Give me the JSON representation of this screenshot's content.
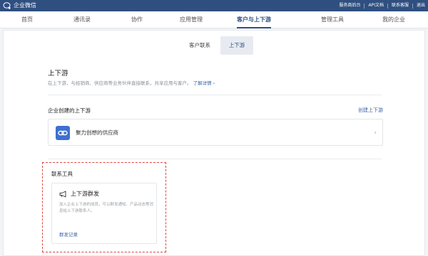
{
  "topbar": {
    "brand": "企业微信",
    "links": [
      "服务商后台",
      "API文档",
      "联系客服",
      "退出"
    ]
  },
  "nav": {
    "items": [
      "首页",
      "通讯录",
      "协作",
      "应用管理",
      "客户与上下游",
      "管理工具",
      "我的企业"
    ],
    "active": "客户与上下游"
  },
  "subtabs": {
    "items": [
      "客户联系",
      "上下游"
    ],
    "active": "上下游"
  },
  "section": {
    "title": "上下游",
    "description": "在上下游，与经销商、供应商等业务伙伴直接联系，共享应用与客户。",
    "learn_more": "了解详情 ›"
  },
  "created": {
    "title": "企业创建的上下游",
    "create_link": "创建上下游",
    "items": [
      {
        "name": "聚力创想的供应商",
        "icon": "link-icon"
      }
    ]
  },
  "tools": {
    "title": "联系工具",
    "card": {
      "icon": "megaphone-icon",
      "name": "上下游群发",
      "description": "加入企业上下游的成员，可以群发通知、产品动态等消息给上下游联系人。",
      "link": "群发记录"
    }
  },
  "colors": {
    "topbar": "#2f4f80",
    "accent": "#3a64a8",
    "highlight_border": "#e0443e"
  }
}
